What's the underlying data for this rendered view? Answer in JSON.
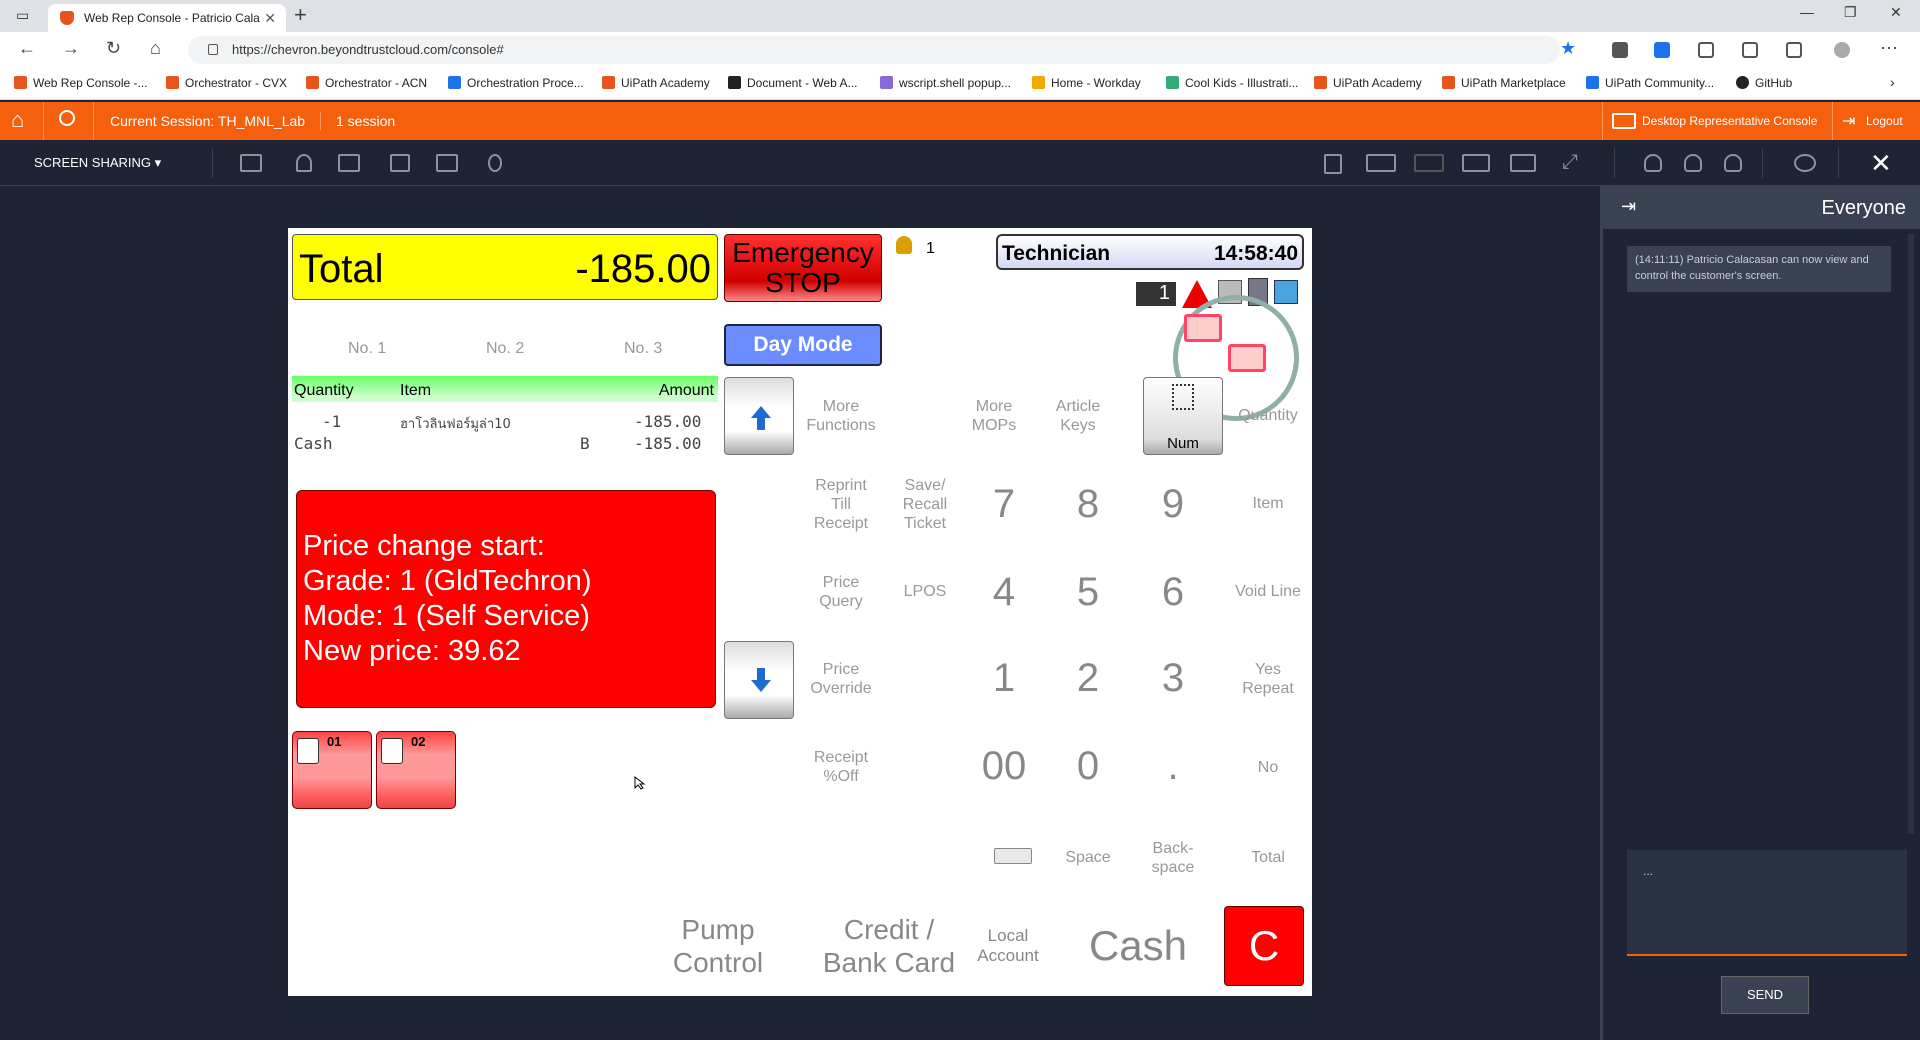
{
  "browser": {
    "tab_title": "Web Rep Console - Patricio Cala",
    "url": "https://chevron.beyondtrustcloud.com/console#",
    "bookmarks": [
      "Web Rep Console -...",
      "Orchestrator - CVX",
      "Orchestrator - ACN",
      "Orchestration Proce...",
      "UiPath Academy",
      "Document - Web A...",
      "wscript.shell popup...",
      "Home - Workday",
      "Cool Kids - Illustrati...",
      "UiPath Academy",
      "UiPath Marketplace",
      "UiPath Community...",
      "GitHub"
    ]
  },
  "topbar": {
    "session": "Current Session: TH_MNL_Lab",
    "count": "1 session",
    "desktop_console": "Desktop Representative Console",
    "logout": "Logout"
  },
  "toolbar": {
    "screen_sharing": "SCREEN SHARING"
  },
  "pos": {
    "total_label": "Total",
    "total_value": "-185.00",
    "emergency_1": "Emergency",
    "emergency_2": "STOP",
    "person_count": "1",
    "tech_label": "Technician",
    "time": "14:58:40",
    "badge": "1",
    "day_mode": "Day Mode",
    "nos": [
      "No. 1",
      "No. 2",
      "No. 3"
    ],
    "table_headers": {
      "qty": "Quantity",
      "item": "Item",
      "amount": "Amount"
    },
    "row1": {
      "qty": "-1",
      "item": "ฮาโวลินฟอร์มูล่า10",
      "amount": "-185.00"
    },
    "row2": {
      "qty": "Cash",
      "flag": "B",
      "amount": "-185.00"
    },
    "price_lines": [
      "Price change start:",
      "Grade: 1 (GldTechron)",
      "Mode: 1 (Self Service)",
      "New price: 39.62"
    ],
    "pumps": [
      "01",
      "02"
    ],
    "keys": {
      "more_functions": [
        "More",
        "Functions"
      ],
      "more_mops": [
        "More",
        "MOPs"
      ],
      "article_keys": [
        "Article",
        "Keys"
      ],
      "num": "Num",
      "quantity": "Quantity",
      "reprint": [
        "Reprint",
        "Till",
        "Receipt"
      ],
      "save_recall": [
        "Save/",
        "Recall",
        "Ticket"
      ],
      "item": "Item",
      "price_query": [
        "Price",
        "Query"
      ],
      "lpos": "LPOS",
      "void_line": "Void Line",
      "price_override": [
        "Price",
        "Override"
      ],
      "yes_repeat": [
        "Yes",
        "Repeat"
      ],
      "receipt_off": [
        "Receipt",
        "%Off"
      ],
      "no": "No",
      "space": "Space",
      "backspace": [
        "Back-",
        "space"
      ],
      "total": "Total",
      "digits": [
        "7",
        "8",
        "9",
        "4",
        "5",
        "6",
        "1",
        "2",
        "3",
        "00",
        "0",
        "."
      ],
      "pump_control": [
        "Pump",
        "Control"
      ],
      "credit": [
        "Credit /",
        "Bank Card"
      ],
      "local_account": [
        "Local",
        "Account"
      ],
      "cash": "Cash",
      "clear": "C"
    }
  },
  "chat": {
    "header": "Everyone",
    "message": "(14:11:11) Patricio Calacasan can now view and control the customer's screen.",
    "input": "...",
    "send": "SEND"
  }
}
